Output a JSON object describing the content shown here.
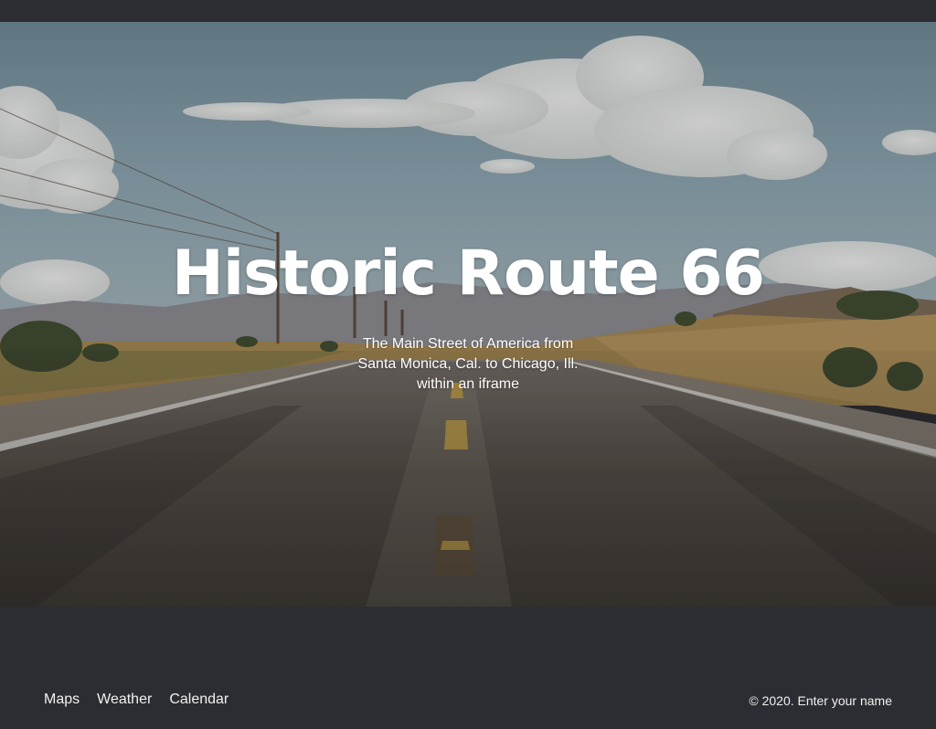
{
  "hero": {
    "title": "Historic Route 66",
    "subtitle_lines": [
      "The Main Street of America from",
      "Santa Monica, Cal. to Chicago, Ill.",
      "within an iframe"
    ]
  },
  "footer": {
    "nav": [
      {
        "label": "Maps"
      },
      {
        "label": "Weather"
      },
      {
        "label": "Calendar"
      }
    ],
    "copyright": "© 2020. Enter your name"
  },
  "colors": {
    "background_dark": "#2c2d32",
    "text_light": "#f1f1f1",
    "road_line_yellow": "#c9a13c"
  }
}
